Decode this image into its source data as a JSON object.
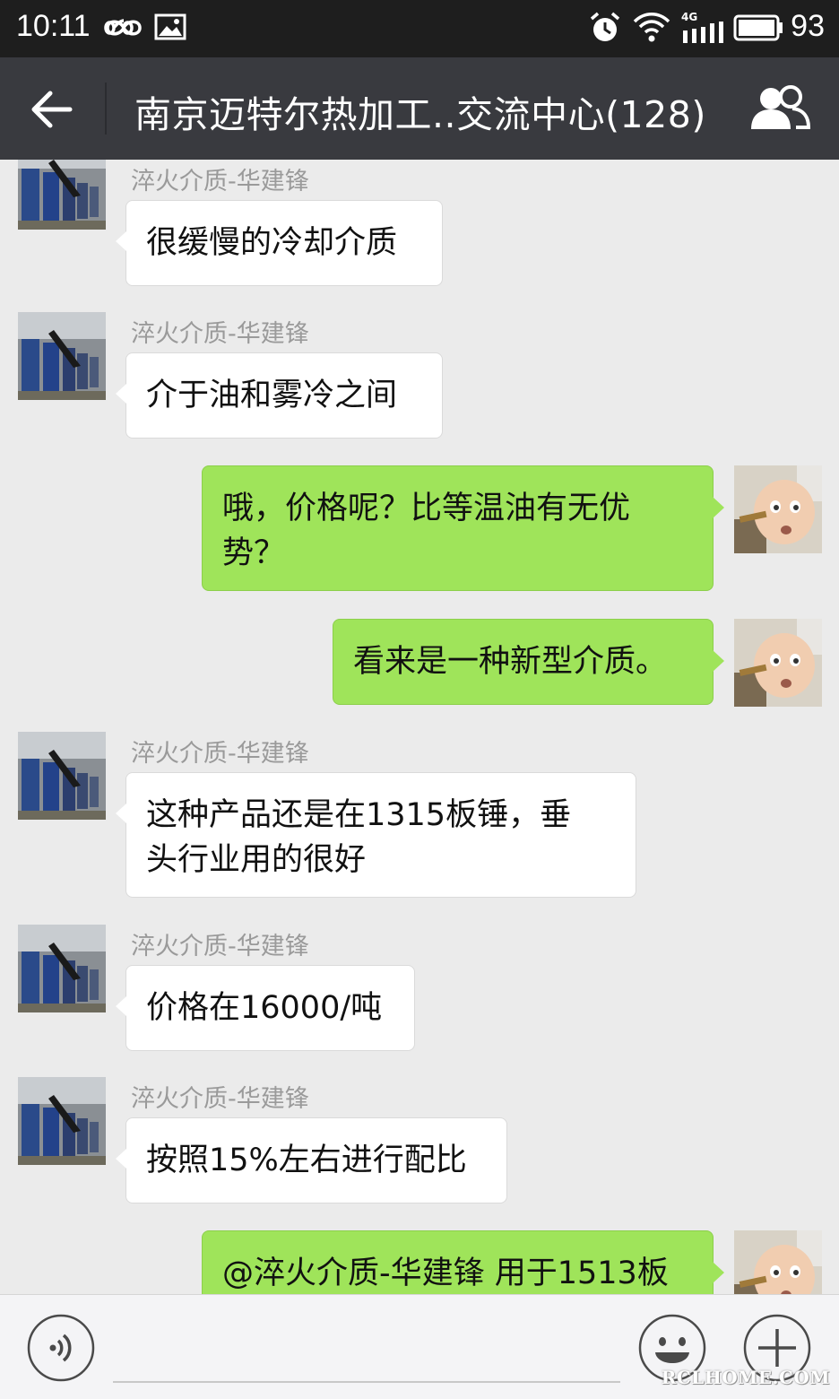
{
  "status_bar": {
    "time": "10:11",
    "battery_level": "93",
    "network": "4G",
    "icons": [
      "infinity-icon",
      "image-icon",
      "alarm-icon",
      "wifi-icon",
      "signal-icon",
      "battery-icon"
    ]
  },
  "header": {
    "title": "南京迈特尔热加工..交流中心(128)",
    "back_icon": "back-arrow-icon",
    "members_icon": "group-members-icon"
  },
  "messages": [
    {
      "direction": "in",
      "sender": "淬火介质-华建锋",
      "lines": [
        "很缓慢的冷却介质"
      ]
    },
    {
      "direction": "in",
      "sender": "淬火介质-华建锋",
      "lines": [
        "介于油和雾冷之间"
      ]
    },
    {
      "direction": "out",
      "sender": "",
      "lines": [
        "哦，价格呢？比等温油有无优",
        "势？"
      ]
    },
    {
      "direction": "out",
      "sender": "",
      "lines": [
        "看来是一种新型介质。"
      ]
    },
    {
      "direction": "in",
      "sender": "淬火介质-华建锋",
      "lines": [
        "这种产品还是在1315板锤，垂",
        "头行业用的很好"
      ]
    },
    {
      "direction": "in",
      "sender": "淬火介质-华建锋",
      "lines": [
        "价格在16000/吨"
      ]
    },
    {
      "direction": "in",
      "sender": "淬火介质-华建锋",
      "lines": [
        "按照15%左右进行配比"
      ]
    },
    {
      "direction": "out",
      "sender": "",
      "lines": [
        "@淬火介质-华建锋 用于1513板"
      ]
    }
  ],
  "input_bar": {
    "voice_icon": "voice-icon",
    "emoji_icon": "emoji-icon",
    "add_icon": "plus-icon",
    "watermark": "RCLHOME.COM"
  },
  "colors": {
    "status_bar_bg": "#1e1e1e",
    "title_bar_bg": "#393a3f",
    "chat_bg": "#ebebeb",
    "outgoing_bubble": "#9fe45a",
    "incoming_bubble": "#ffffff"
  }
}
